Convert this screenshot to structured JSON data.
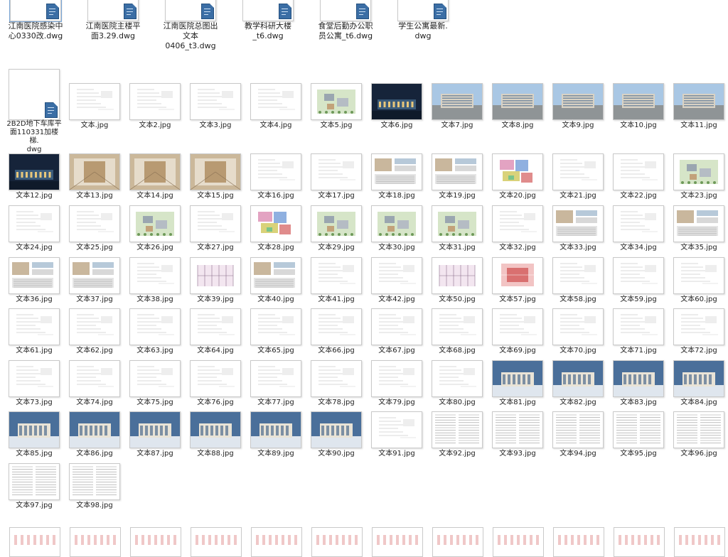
{
  "top_files": [
    {
      "label": "江南医院感染中\n心0330改.dwg"
    },
    {
      "label": "江南医院主楼平\n面3.29.dwg"
    },
    {
      "label": "江南医院总图出\n文本\n0406_t3.dwg"
    },
    {
      "label": "教学科研大楼\n_t6.dwg"
    },
    {
      "label": "食堂后勤办公职\n员公寓_t6.dwg"
    },
    {
      "label": "学生公寓最新.\ndwg"
    }
  ],
  "special_file": {
    "label": "2B2D地下车库平\n面110331加楼梯.\ndwg"
  },
  "rows": [
    [
      "文本.jpg",
      "文本2.jpg",
      "文本3.jpg",
      "文本4.jpg",
      "文本5.jpg",
      "文本6.jpg",
      "文本7.jpg",
      "文本8.jpg",
      "文本9.jpg",
      "文本10.jpg",
      "文本11.jpg"
    ],
    [
      "文本12.jpg",
      "文本13.jpg",
      "文本14.jpg",
      "文本15.jpg",
      "文本16.jpg",
      "文本17.jpg",
      "文本18.jpg",
      "文本19.jpg",
      "文本20.jpg",
      "文本21.jpg",
      "文本22.jpg",
      "文本23.jpg"
    ],
    [
      "文本24.jpg",
      "文本25.jpg",
      "文本26.jpg",
      "文本27.jpg",
      "文本28.jpg",
      "文本29.jpg",
      "文本30.jpg",
      "文本31.jpg",
      "文本32.jpg",
      "文本33.jpg",
      "文本34.jpg",
      "文本35.jpg"
    ],
    [
      "文本36.jpg",
      "文本37.jpg",
      "文本38.jpg",
      "文本39.jpg",
      "文本40.jpg",
      "文本41.jpg",
      "文本42.jpg",
      "文本50.jpg",
      "文本57.jpg",
      "文本58.jpg",
      "文本59.jpg",
      "文本60.jpg"
    ],
    [
      "文本61.jpg",
      "文本62.jpg",
      "文本63.jpg",
      "文本64.jpg",
      "文本65.jpg",
      "文本66.jpg",
      "文本67.jpg",
      "文本68.jpg",
      "文本69.jpg",
      "文本70.jpg",
      "文本71.jpg",
      "文本72.jpg"
    ],
    [
      "文本73.jpg",
      "文本74.jpg",
      "文本75.jpg",
      "文本76.jpg",
      "文本77.jpg",
      "文本78.jpg",
      "文本79.jpg",
      "文本80.jpg",
      "文本81.jpg",
      "文本82.jpg",
      "文本83.jpg",
      "文本84.jpg"
    ],
    [
      "文本85.jpg",
      "文本86.jpg",
      "文本87.jpg",
      "文本88.jpg",
      "文本89.jpg",
      "文本90.jpg",
      "文本91.jpg",
      "文本92.jpg",
      "文本93.jpg",
      "文本94.jpg",
      "文本95.jpg",
      "文本96.jpg"
    ],
    [
      "文本97.jpg",
      "文本98.jpg"
    ]
  ],
  "thumb_styles": {
    "文本5.jpg": "site",
    "文本6.jpg": "night",
    "文本7.jpg": "photo",
    "文本8.jpg": "photo",
    "文本9.jpg": "photo",
    "文本10.jpg": "photo",
    "文本11.jpg": "photo",
    "文本12.jpg": "night",
    "文本13.jpg": "interior",
    "文本14.jpg": "interior",
    "文本15.jpg": "interior",
    "文本18.jpg": "mixed",
    "文本19.jpg": "mixed",
    "文本20.jpg": "colormap",
    "文本23.jpg": "site",
    "文本26.jpg": "site",
    "文本28.jpg": "colormap",
    "文本29.jpg": "site",
    "文本30.jpg": "site",
    "文本31.jpg": "site",
    "文本33.jpg": "mixed",
    "文本35.jpg": "mixed",
    "文本36.jpg": "mixed",
    "文本37.jpg": "mixed",
    "文本39.jpg": "plan",
    "文本40.jpg": "mixed",
    "文本50.jpg": "plan",
    "文本57.jpg": "redplan",
    "文本81.jpg": "elev",
    "文本82.jpg": "elev",
    "文本83.jpg": "elev",
    "文本84.jpg": "elev",
    "文本85.jpg": "elev",
    "文本86.jpg": "elev",
    "文本87.jpg": "elev",
    "文本88.jpg": "elev",
    "文本89.jpg": "elev",
    "文本90.jpg": "elev",
    "文本92.jpg": "text",
    "文本93.jpg": "text",
    "文本94.jpg": "text",
    "文本95.jpg": "text",
    "文本96.jpg": "text",
    "文本97.jpg": "text",
    "文本98.jpg": "text"
  },
  "colors": {
    "label": "#222222",
    "dwg_icon": "#3b6ea5",
    "selection": "#7aa7d8",
    "watermark": "#c8c8c8"
  }
}
